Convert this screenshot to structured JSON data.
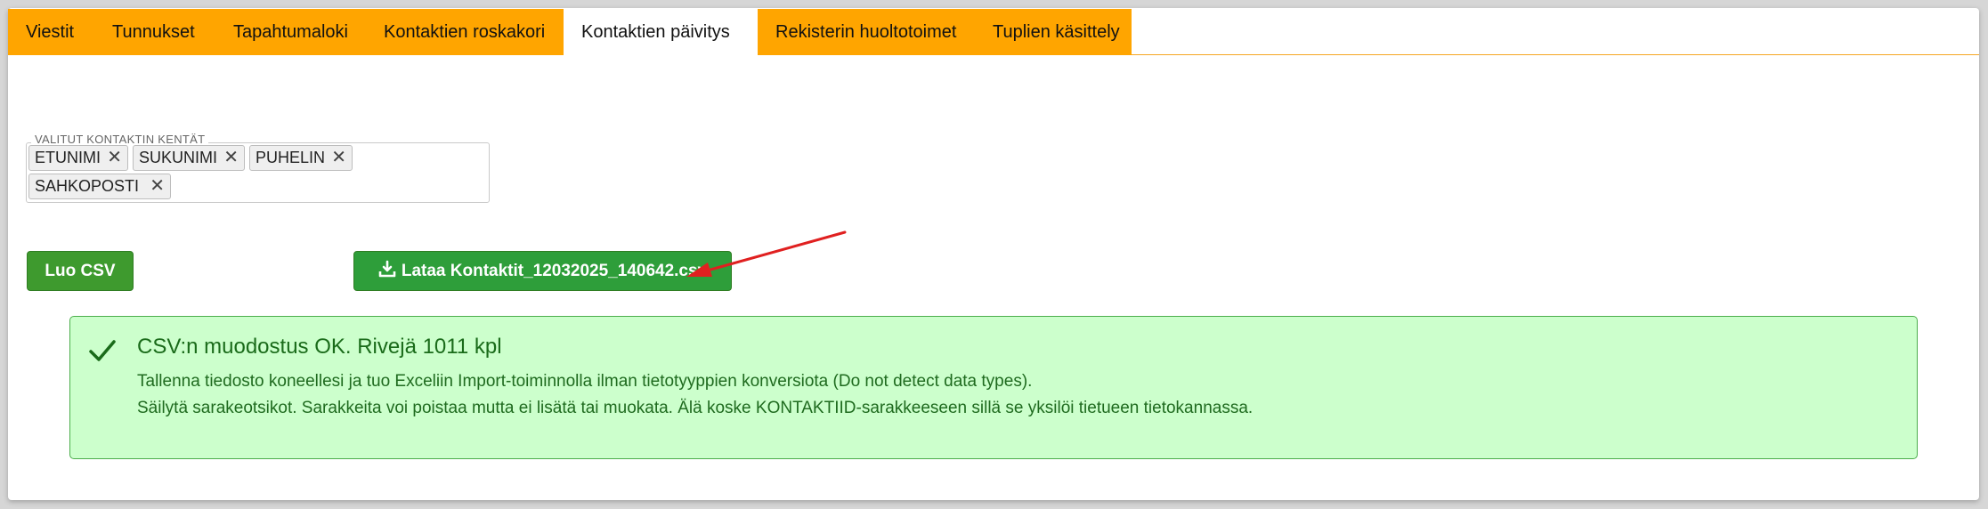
{
  "tabs": [
    {
      "label": "Viestit",
      "active": false
    },
    {
      "label": "Tunnukset",
      "active": false
    },
    {
      "label": "Tapahtumaloki",
      "active": false
    },
    {
      "label": "Kontaktien roskakori",
      "active": false
    },
    {
      "label": "Kontaktien päivitys",
      "active": true
    },
    {
      "label": "Rekisterin huoltotoimet",
      "active": false
    },
    {
      "label": "Tuplien käsittely",
      "active": false
    }
  ],
  "fields": {
    "legend": "VALITUT KONTAKTIN KENTÄT",
    "chips": [
      "ETUNIMI",
      "SUKUNIMI",
      "PUHELIN",
      "SAHKOPOSTI"
    ],
    "remove_glyph": "✕"
  },
  "actions": {
    "create_csv_label": "Luo CSV",
    "download_label": "Lataa Kontaktit_12032025_140642.csv"
  },
  "alert": {
    "title": "CSV:n muodostus OK. Rivejä 1011 kpl",
    "line1": "Tallenna tiedosto koneellesi ja tuo Exceliin Import-toiminnolla ilman tietotyyppien konversiota (Do not detect data types).",
    "line2": "Säilytä sarakeotsikot. Sarakkeita voi poistaa mutta ei lisätä tai muokata. Älä koske KONTAKTIID-sarakkeeseen sillä se yksilöi tietueen tietokannassa."
  },
  "colors": {
    "tab_bg": "#ffa500",
    "button_green": "#3e9a2e",
    "alert_bg": "#ccffcc",
    "alert_text": "#1a6b1a",
    "annotation_arrow": "#e02020"
  },
  "icons": {
    "download": "download-icon",
    "success": "check-icon",
    "annotation": "red-arrow"
  }
}
